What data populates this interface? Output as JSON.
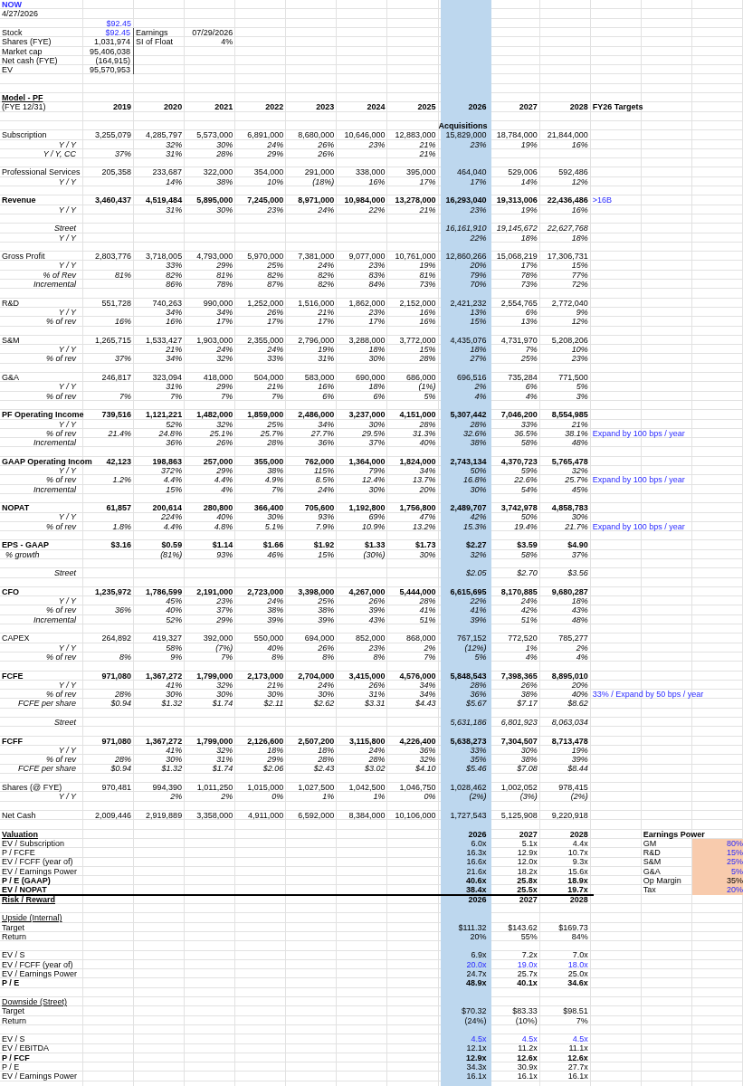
{
  "rows": [
    {
      "kind": "title",
      "text": "NOW"
    },
    {
      "kind": "date",
      "text": "4/27/2026"
    },
    {
      "kind": "price",
      "value": "$92.45"
    },
    {
      "kind": "summary",
      "label": "Stock",
      "value": "$92.45",
      "input": true,
      "side_label": "Earnings",
      "side_value": "07/29/2026"
    },
    {
      "kind": "summary",
      "label": "Shares (FYE)",
      "value": "1,031,974",
      "input": false,
      "side_label": "SI of Float",
      "side_value": "4%"
    },
    {
      "kind": "summary",
      "label": "Market cap",
      "value": "95,406,038",
      "input": false
    },
    {
      "kind": "summary",
      "label": "Net cash (FYE)",
      "value": "(164,915)",
      "input": false
    },
    {
      "kind": "summary",
      "label": "EV",
      "value": "95,570,953",
      "input": false
    },
    {
      "kind": "spacer"
    },
    {
      "kind": "spacer"
    },
    {
      "kind": "section",
      "label": "Model - PF"
    },
    {
      "kind": "header",
      "label": "(FYE 12/31)",
      "years": [
        "2019",
        "2020",
        "2021",
        "2022",
        "2023",
        "2024",
        "2025",
        "2026",
        "2027",
        "2028"
      ],
      "note": "FY26 Targets"
    },
    {
      "kind": "spacer"
    },
    {
      "kind": "total",
      "values": {
        "2026": "Acquisitions"
      }
    },
    {
      "kind": "line",
      "label": "Subscription",
      "values": {
        "2019": "3,255,079",
        "2020": "4,285,797",
        "2021": "5,573,000",
        "2022": "6,891,000",
        "2023": "8,680,000",
        "2024": "10,646,000",
        "2025": "12,883,000",
        "2026": "15,829,000",
        "2027": "18,784,000",
        "2028": "21,844,000"
      }
    },
    {
      "kind": "ratio",
      "label": "Y / Y",
      "values": {
        "2020": "32%",
        "2021": "30%",
        "2022": "24%",
        "2023": "26%",
        "2024": "23%",
        "2025": "21%",
        "2026": "23%",
        "2027": "19%",
        "2028": "16%"
      }
    },
    {
      "kind": "ratio",
      "label": "Y / Y, CC",
      "values": {
        "2019": "37%",
        "2020": "31%",
        "2021": "28%",
        "2022": "29%",
        "2023": "26%",
        "2025": "21%"
      }
    },
    {
      "kind": "spacer"
    },
    {
      "kind": "line",
      "label": "Professional Services",
      "values": {
        "2019": "205,358",
        "2020": "233,687",
        "2021": "322,000",
        "2022": "354,000",
        "2023": "291,000",
        "2024": "338,000",
        "2025": "395,000",
        "2026": "464,040",
        "2027": "529,006",
        "2028": "592,486"
      }
    },
    {
      "kind": "ratio",
      "label": "Y / Y",
      "values": {
        "2020": "14%",
        "2021": "38%",
        "2022": "10%",
        "2023": "(18%)",
        "2024": "16%",
        "2025": "17%",
        "2026": "17%",
        "2027": "14%",
        "2028": "12%"
      }
    },
    {
      "kind": "spacer"
    },
    {
      "kind": "total",
      "label": "Revenue",
      "values": {
        "2019": "3,460,437",
        "2020": "4,519,484",
        "2021": "5,895,000",
        "2022": "7,245,000",
        "2023": "8,971,000",
        "2024": "10,984,000",
        "2025": "13,278,000",
        "2026": "16,293,040",
        "2027": "19,313,006",
        "2028": "22,436,486"
      },
      "note": ">16B"
    },
    {
      "kind": "ratio",
      "label": "Y / Y",
      "values": {
        "2020": "31%",
        "2021": "30%",
        "2022": "23%",
        "2023": "24%",
        "2024": "22%",
        "2025": "21%",
        "2026": "23%",
        "2027": "19%",
        "2028": "16%"
      }
    },
    {
      "kind": "spacer"
    },
    {
      "kind": "ratio",
      "label": "Street",
      "values": {
        "2026": "16,161,910",
        "2027": "19,145,672",
        "2028": "22,627,768"
      }
    },
    {
      "kind": "ratio",
      "label": "Y / Y",
      "values": {
        "2026": "22%",
        "2027": "18%",
        "2028": "18%"
      }
    },
    {
      "kind": "spacer"
    },
    {
      "kind": "line",
      "label": "Gross Profit",
      "values": {
        "2019": "2,803,776",
        "2020": "3,718,005",
        "2021": "4,793,000",
        "2022": "5,970,000",
        "2023": "7,381,000",
        "2024": "9,077,000",
        "2025": "10,761,000",
        "2026": "12,860,266",
        "2027": "15,068,219",
        "2028": "17,306,731"
      }
    },
    {
      "kind": "ratio",
      "label": "Y / Y",
      "values": {
        "2020": "33%",
        "2021": "29%",
        "2022": "25%",
        "2023": "24%",
        "2024": "23%",
        "2025": "19%",
        "2026": "20%",
        "2027": "17%",
        "2028": "15%"
      }
    },
    {
      "kind": "ratio",
      "label": "% of Rev",
      "values": {
        "2019": "81%",
        "2020": "82%",
        "2021": "81%",
        "2022": "82%",
        "2023": "82%",
        "2024": "83%",
        "2025": "81%",
        "2026": "79%",
        "2027": "78%",
        "2028": "77%"
      }
    },
    {
      "kind": "ratio",
      "label": "Incremental",
      "values": {
        "2020": "86%",
        "2021": "78%",
        "2022": "87%",
        "2023": "82%",
        "2024": "84%",
        "2025": "73%",
        "2026": "70%",
        "2027": "73%",
        "2028": "72%"
      }
    },
    {
      "kind": "spacer"
    },
    {
      "kind": "line",
      "label": "R&D",
      "values": {
        "2019": "551,728",
        "2020": "740,263",
        "2021": "990,000",
        "2022": "1,252,000",
        "2023": "1,516,000",
        "2024": "1,862,000",
        "2025": "2,152,000",
        "2026": "2,421,232",
        "2027": "2,554,765",
        "2028": "2,772,040"
      }
    },
    {
      "kind": "ratio",
      "label": "Y / Y",
      "values": {
        "2020": "34%",
        "2021": "34%",
        "2022": "26%",
        "2023": "21%",
        "2024": "23%",
        "2025": "16%",
        "2026": "13%",
        "2027": "6%",
        "2028": "9%"
      }
    },
    {
      "kind": "ratio",
      "label": "% of rev",
      "values": {
        "2019": "16%",
        "2020": "16%",
        "2021": "17%",
        "2022": "17%",
        "2023": "17%",
        "2024": "17%",
        "2025": "16%",
        "2026": "15%",
        "2027": "13%",
        "2028": "12%"
      }
    },
    {
      "kind": "spacer"
    },
    {
      "kind": "line",
      "label": "S&M",
      "values": {
        "2019": "1,265,715",
        "2020": "1,533,427",
        "2021": "1,903,000",
        "2022": "2,355,000",
        "2023": "2,796,000",
        "2024": "3,288,000",
        "2025": "3,772,000",
        "2026": "4,435,076",
        "2027": "4,731,970",
        "2028": "5,208,206"
      }
    },
    {
      "kind": "ratio",
      "label": "Y / Y",
      "values": {
        "2020": "21%",
        "2021": "24%",
        "2022": "24%",
        "2023": "19%",
        "2024": "18%",
        "2025": "15%",
        "2026": "18%",
        "2027": "7%",
        "2028": "10%"
      }
    },
    {
      "kind": "ratio",
      "label": "% of rev",
      "values": {
        "2019": "37%",
        "2020": "34%",
        "2021": "32%",
        "2022": "33%",
        "2023": "31%",
        "2024": "30%",
        "2025": "28%",
        "2026": "27%",
        "2027": "25%",
        "2028": "23%"
      }
    },
    {
      "kind": "spacer"
    },
    {
      "kind": "line",
      "label": "G&A",
      "values": {
        "2019": "246,817",
        "2020": "323,094",
        "2021": "418,000",
        "2022": "504,000",
        "2023": "583,000",
        "2024": "690,000",
        "2025": "686,000",
        "2026": "696,516",
        "2027": "735,284",
        "2028": "771,500"
      }
    },
    {
      "kind": "ratio",
      "label": "Y / Y",
      "values": {
        "2020": "31%",
        "2021": "29%",
        "2022": "21%",
        "2023": "16%",
        "2024": "18%",
        "2025": "(1%)",
        "2026": "2%",
        "2027": "6%",
        "2028": "5%"
      }
    },
    {
      "kind": "ratio",
      "label": "% of rev",
      "values": {
        "2019": "7%",
        "2020": "7%",
        "2021": "7%",
        "2022": "7%",
        "2023": "6%",
        "2024": "6%",
        "2025": "5%",
        "2026": "4%",
        "2027": "4%",
        "2028": "3%"
      }
    },
    {
      "kind": "spacer"
    },
    {
      "kind": "total",
      "label": "PF Operating Income",
      "values": {
        "2019": "739,516",
        "2020": "1,121,221",
        "2021": "1,482,000",
        "2022": "1,859,000",
        "2023": "2,486,000",
        "2024": "3,237,000",
        "2025": "4,151,000",
        "2026": "5,307,442",
        "2027": "7,046,200",
        "2028": "8,554,985"
      }
    },
    {
      "kind": "ratio",
      "label": "Y / Y",
      "values": {
        "2020": "52%",
        "2021": "32%",
        "2022": "25%",
        "2023": "34%",
        "2024": "30%",
        "2025": "28%",
        "2026": "28%",
        "2027": "33%",
        "2028": "21%"
      }
    },
    {
      "kind": "ratio",
      "label": "% of rev",
      "values": {
        "2019": "21.4%",
        "2020": "24.8%",
        "2021": "25.1%",
        "2022": "25.7%",
        "2023": "27.7%",
        "2024": "29.5%",
        "2025": "31.3%",
        "2026": "32.6%",
        "2027": "36.5%",
        "2028": "38.1%"
      },
      "note": "Expand by 100 bps / year"
    },
    {
      "kind": "ratio",
      "label": "Incremental",
      "values": {
        "2020": "36%",
        "2021": "26%",
        "2022": "28%",
        "2023": "36%",
        "2024": "37%",
        "2025": "40%",
        "2026": "38%",
        "2027": "58%",
        "2028": "48%"
      }
    },
    {
      "kind": "spacer"
    },
    {
      "kind": "total",
      "label": "GAAP Operating Incom",
      "values": {
        "2019": "42,123",
        "2020": "198,863",
        "2021": "257,000",
        "2022": "355,000",
        "2023": "762,000",
        "2024": "1,364,000",
        "2025": "1,824,000",
        "2026": "2,743,134",
        "2027": "4,370,723",
        "2028": "5,765,478"
      }
    },
    {
      "kind": "ratio",
      "label": "Y / Y",
      "values": {
        "2020": "372%",
        "2021": "29%",
        "2022": "38%",
        "2023": "115%",
        "2024": "79%",
        "2025": "34%",
        "2026": "50%",
        "2027": "59%",
        "2028": "32%"
      }
    },
    {
      "kind": "ratio",
      "label": "% of rev",
      "values": {
        "2019": "1.2%",
        "2020": "4.4%",
        "2021": "4.4%",
        "2022": "4.9%",
        "2023": "8.5%",
        "2024": "12.4%",
        "2025": "13.7%",
        "2026": "16.8%",
        "2027": "22.6%",
        "2028": "25.7%"
      },
      "note": "Expand by 100 bps / year"
    },
    {
      "kind": "ratio",
      "label": "Incremental",
      "values": {
        "2020": "15%",
        "2021": "4%",
        "2022": "7%",
        "2023": "24%",
        "2024": "30%",
        "2025": "20%",
        "2026": "30%",
        "2027": "54%",
        "2028": "45%"
      }
    },
    {
      "kind": "spacer"
    },
    {
      "kind": "total",
      "label": "NOPAT",
      "values": {
        "2019": "61,857",
        "2020": "200,614",
        "2021": "280,800",
        "2022": "366,400",
        "2023": "705,600",
        "2024": "1,192,800",
        "2025": "1,756,800",
        "2026": "2,489,707",
        "2027": "3,742,978",
        "2028": "4,858,783"
      }
    },
    {
      "kind": "ratio",
      "label": "Y / Y",
      "values": {
        "2020": "224%",
        "2021": "40%",
        "2022": "30%",
        "2023": "93%",
        "2024": "69%",
        "2025": "47%",
        "2026": "42%",
        "2027": "50%",
        "2028": "30%"
      }
    },
    {
      "kind": "ratio",
      "label": "% of rev",
      "values": {
        "2019": "1.8%",
        "2020": "4.4%",
        "2021": "4.8%",
        "2022": "5.1%",
        "2023": "7.9%",
        "2024": "10.9%",
        "2025": "13.2%",
        "2026": "15.3%",
        "2027": "19.4%",
        "2028": "21.7%"
      },
      "note": "Expand by 100 bps / year"
    },
    {
      "kind": "spacer"
    },
    {
      "kind": "total",
      "label": "EPS - GAAP",
      "values": {
        "2019": "$3.16",
        "2020": "$0.59",
        "2021": "$1.14",
        "2022": "$1.66",
        "2023": "$1.92",
        "2024": "$1.33",
        "2025": "$1.73",
        "2026": "$2.27",
        "2027": "$3.59",
        "2028": "$4.90"
      }
    },
    {
      "kind": "growth",
      "label": "% growth",
      "values": {
        "2020": "(81%)",
        "2021": "93%",
        "2022": "46%",
        "2023": "15%",
        "2024": "(30%)",
        "2025": "30%",
        "2026": "32%",
        "2027": "58%",
        "2028": "37%"
      }
    },
    {
      "kind": "spacer"
    },
    {
      "kind": "ratio",
      "label": "Street",
      "values": {
        "2026": "$2.05",
        "2027": "$2.70",
        "2028": "$3.56"
      }
    },
    {
      "kind": "spacer"
    },
    {
      "kind": "total",
      "label": "CFO",
      "values": {
        "2019": "1,235,972",
        "2020": "1,786,599",
        "2021": "2,191,000",
        "2022": "2,723,000",
        "2023": "3,398,000",
        "2024": "4,267,000",
        "2025": "5,444,000",
        "2026": "6,615,695",
        "2027": "8,170,885",
        "2028": "9,680,287"
      }
    },
    {
      "kind": "ratio",
      "label": "Y / Y",
      "values": {
        "2020": "45%",
        "2021": "23%",
        "2022": "24%",
        "2023": "25%",
        "2024": "26%",
        "2025": "28%",
        "2026": "22%",
        "2027": "24%",
        "2028": "18%"
      }
    },
    {
      "kind": "ratio",
      "label": "% of rev",
      "values": {
        "2019": "36%",
        "2020": "40%",
        "2021": "37%",
        "2022": "38%",
        "2023": "38%",
        "2024": "39%",
        "2025": "41%",
        "2026": "41%",
        "2027": "42%",
        "2028": "43%"
      }
    },
    {
      "kind": "ratio",
      "label": "Incremental",
      "values": {
        "2020": "52%",
        "2021": "29%",
        "2022": "39%",
        "2023": "39%",
        "2024": "43%",
        "2025": "51%",
        "2026": "39%",
        "2027": "51%",
        "2028": "48%"
      }
    },
    {
      "kind": "spacer"
    },
    {
      "kind": "line",
      "label": "CAPEX",
      "values": {
        "2019": "264,892",
        "2020": "419,327",
        "2021": "392,000",
        "2022": "550,000",
        "2023": "694,000",
        "2024": "852,000",
        "2025": "868,000",
        "2026": "767,152",
        "2027": "772,520",
        "2028": "785,277"
      }
    },
    {
      "kind": "ratio",
      "label": "Y / Y",
      "values": {
        "2020": "58%",
        "2021": "(7%)",
        "2022": "40%",
        "2023": "26%",
        "2024": "23%",
        "2025": "2%",
        "2026": "(12%)",
        "2027": "1%",
        "2028": "2%"
      }
    },
    {
      "kind": "ratio",
      "label": "% of rev",
      "values": {
        "2019": "8%",
        "2020": "9%",
        "2021": "7%",
        "2022": "8%",
        "2023": "8%",
        "2024": "8%",
        "2025": "7%",
        "2026": "5%",
        "2027": "4%",
        "2028": "4%"
      }
    },
    {
      "kind": "spacer"
    },
    {
      "kind": "total",
      "label": "FCFE",
      "values": {
        "2019": "971,080",
        "2020": "1,367,272",
        "2021": "1,799,000",
        "2022": "2,173,000",
        "2023": "2,704,000",
        "2024": "3,415,000",
        "2025": "4,576,000",
        "2026": "5,848,543",
        "2027": "7,398,365",
        "2028": "8,895,010"
      }
    },
    {
      "kind": "ratio",
      "label": "Y / Y",
      "values": {
        "2020": "41%",
        "2021": "32%",
        "2022": "21%",
        "2023": "24%",
        "2024": "26%",
        "2025": "34%",
        "2026": "28%",
        "2027": "26%",
        "2028": "20%"
      }
    },
    {
      "kind": "ratio",
      "label": "% of rev",
      "values": {
        "2019": "28%",
        "2020": "30%",
        "2021": "30%",
        "2022": "30%",
        "2023": "30%",
        "2024": "31%",
        "2025": "34%",
        "2026": "36%",
        "2027": "38%",
        "2028": "40%"
      },
      "note": "33% / Expand by 50 bps / year"
    },
    {
      "kind": "ratio",
      "label": "FCFE per share",
      "values": {
        "2019": "$0.94",
        "2020": "$1.32",
        "2021": "$1.74",
        "2022": "$2.11",
        "2023": "$2.62",
        "2024": "$3.31",
        "2025": "$4.43",
        "2026": "$5.67",
        "2027": "$7.17",
        "2028": "$8.62"
      }
    },
    {
      "kind": "spacer"
    },
    {
      "kind": "ratio",
      "label": "Street",
      "values": {
        "2026": "5,631,186",
        "2027": "6,801,923",
        "2028": "8,063,034"
      }
    },
    {
      "kind": "spacer"
    },
    {
      "kind": "total",
      "label": "FCFF",
      "values": {
        "2019": "971,080",
        "2020": "1,367,272",
        "2021": "1,799,000",
        "2022": "2,126,600",
        "2023": "2,507,200",
        "2024": "3,115,800",
        "2025": "4,226,400",
        "2026": "5,638,273",
        "2027": "7,304,507",
        "2028": "8,713,478"
      }
    },
    {
      "kind": "ratio",
      "label": "Y / Y",
      "values": {
        "2020": "41%",
        "2021": "32%",
        "2022": "18%",
        "2023": "18%",
        "2024": "24%",
        "2025": "36%",
        "2026": "33%",
        "2027": "30%",
        "2028": "19%"
      }
    },
    {
      "kind": "ratio",
      "label": "% of rev",
      "values": {
        "2019": "28%",
        "2020": "30%",
        "2021": "31%",
        "2022": "29%",
        "2023": "28%",
        "2024": "28%",
        "2025": "32%",
        "2026": "35%",
        "2027": "38%",
        "2028": "39%"
      }
    },
    {
      "kind": "ratio",
      "label": "FCFE per share",
      "values": {
        "2019": "$0.94",
        "2020": "$1.32",
        "2021": "$1.74",
        "2022": "$2.06",
        "2023": "$2.43",
        "2024": "$3.02",
        "2025": "$4.10",
        "2026": "$5.46",
        "2027": "$7.08",
        "2028": "$8.44"
      }
    },
    {
      "kind": "spacer"
    },
    {
      "kind": "line",
      "label": "Shares (@ FYE)",
      "values": {
        "2019": "970,481",
        "2020": "994,390",
        "2021": "1,011,250",
        "2022": "1,015,000",
        "2023": "1,027,500",
        "2024": "1,042,500",
        "2025": "1,046,750",
        "2026": "1,028,462",
        "2027": "1,002,052",
        "2028": "978,415"
      }
    },
    {
      "kind": "ratio",
      "label": "Y / Y",
      "values": {
        "2020": "2%",
        "2021": "2%",
        "2022": "0%",
        "2023": "1%",
        "2024": "1%",
        "2025": "0%",
        "2026": "(2%)",
        "2027": "(3%)",
        "2028": "(2%)"
      }
    },
    {
      "kind": "spacer"
    },
    {
      "kind": "line",
      "label": "Net Cash",
      "values": {
        "2019": "2,009,446",
        "2020": "2,919,889",
        "2021": "3,358,000",
        "2022": "4,911,000",
        "2023": "6,592,000",
        "2024": "8,384,000",
        "2025": "10,106,000",
        "2026": "1,727,543",
        "2027": "5,125,908",
        "2028": "9,220,918"
      }
    },
    {
      "kind": "spacer"
    },
    {
      "kind": "section",
      "label": "Valuation",
      "years": [
        "2026",
        "2027",
        "2028"
      ],
      "side_label": "Earnings Power"
    },
    {
      "kind": "metric",
      "label": "EV / Subscription",
      "bold": false,
      "input": false,
      "values": [
        "6.0x",
        "5.1x",
        "4.4x"
      ],
      "side_label": "GM",
      "side_value": "80%",
      "side_input": true
    },
    {
      "kind": "metric",
      "label": "P / FCFE",
      "bold": false,
      "input": false,
      "values": [
        "16.3x",
        "12.9x",
        "10.7x"
      ],
      "side_label": "R&D",
      "side_value": "15%",
      "side_input": true
    },
    {
      "kind": "metric",
      "label": "EV / FCFF (year of)",
      "bold": false,
      "input": false,
      "values": [
        "16.6x",
        "12.0x",
        "9.3x"
      ],
      "side_label": "S&M",
      "side_value": "25%",
      "side_input": true
    },
    {
      "kind": "metric",
      "label": "EV / Earnings Power",
      "bold": false,
      "input": false,
      "values": [
        "21.6x",
        "18.2x",
        "15.6x"
      ],
      "side_label": "G&A",
      "side_value": "5%",
      "side_input": true
    },
    {
      "kind": "metric",
      "label": "P / E (GAAP)",
      "bold": true,
      "input": false,
      "values": [
        "40.6x",
        "25.8x",
        "18.9x"
      ],
      "side_label": "Op Margin",
      "side_value": "35%",
      "side_input": false
    },
    {
      "kind": "metric",
      "label": "EV / NOPAT",
      "bold": true,
      "input": false,
      "values": [
        "38.4x",
        "25.5x",
        "19.7x"
      ],
      "side_label": "Tax",
      "side_value": "20%",
      "side_input": true
    },
    {
      "kind": "rule"
    },
    {
      "kind": "section",
      "label": "Risk / Reward",
      "years": [
        "2026",
        "2027",
        "2028"
      ]
    },
    {
      "kind": "spacer"
    },
    {
      "kind": "subsection",
      "label": "Upside (Internal)"
    },
    {
      "kind": "metric",
      "label": "Target",
      "bold": false,
      "input": false,
      "values": [
        "$111.32",
        "$143.62",
        "$169.73"
      ]
    },
    {
      "kind": "metric",
      "label": "Return",
      "bold": false,
      "input": false,
      "values": [
        "20%",
        "55%",
        "84%"
      ]
    },
    {
      "kind": "spacer"
    },
    {
      "kind": "metric",
      "label": "EV / S",
      "bold": false,
      "input": false,
      "values": [
        "6.9x",
        "7.2x",
        "7.0x"
      ]
    },
    {
      "kind": "metric",
      "label": "EV / FCFF (year of)",
      "bold": false,
      "input": true,
      "values": [
        "20.0x",
        "19.0x",
        "18.0x"
      ]
    },
    {
      "kind": "metric",
      "label": "EV / Earnings Power",
      "bold": false,
      "input": false,
      "values": [
        "24.7x",
        "25.7x",
        "25.0x"
      ]
    },
    {
      "kind": "metric",
      "label": "P / E",
      "bold": true,
      "input": false,
      "values": [
        "48.9x",
        "40.1x",
        "34.6x"
      ]
    },
    {
      "kind": "spacer"
    },
    {
      "kind": "subsection",
      "label": "Downside (Street)"
    },
    {
      "kind": "metric",
      "label": "Target",
      "bold": false,
      "input": false,
      "values": [
        "$70.32",
        "$83.33",
        "$98.51"
      ]
    },
    {
      "kind": "metric",
      "label": "Return",
      "bold": false,
      "input": false,
      "values": [
        "(24%)",
        "(10%)",
        "7%"
      ]
    },
    {
      "kind": "spacer"
    },
    {
      "kind": "metric",
      "label": "EV / S",
      "bold": false,
      "input": true,
      "values": [
        "4.5x",
        "4.5x",
        "4.5x"
      ]
    },
    {
      "kind": "metric",
      "label": "EV / EBITDA",
      "bold": false,
      "input": false,
      "values": [
        "12.1x",
        "11.2x",
        "11.1x"
      ]
    },
    {
      "kind": "metric",
      "label": "P / FCF",
      "bold": true,
      "input": false,
      "values": [
        "12.9x",
        "12.6x",
        "12.6x"
      ]
    },
    {
      "kind": "metric",
      "label": "P / E",
      "bold": false,
      "input": false,
      "values": [
        "34.3x",
        "30.9x",
        "27.7x"
      ]
    },
    {
      "kind": "metric",
      "label": "EV / Earnings Power",
      "bold": false,
      "input": false,
      "values": [
        "16.1x",
        "16.1x",
        "16.1x"
      ]
    }
  ]
}
